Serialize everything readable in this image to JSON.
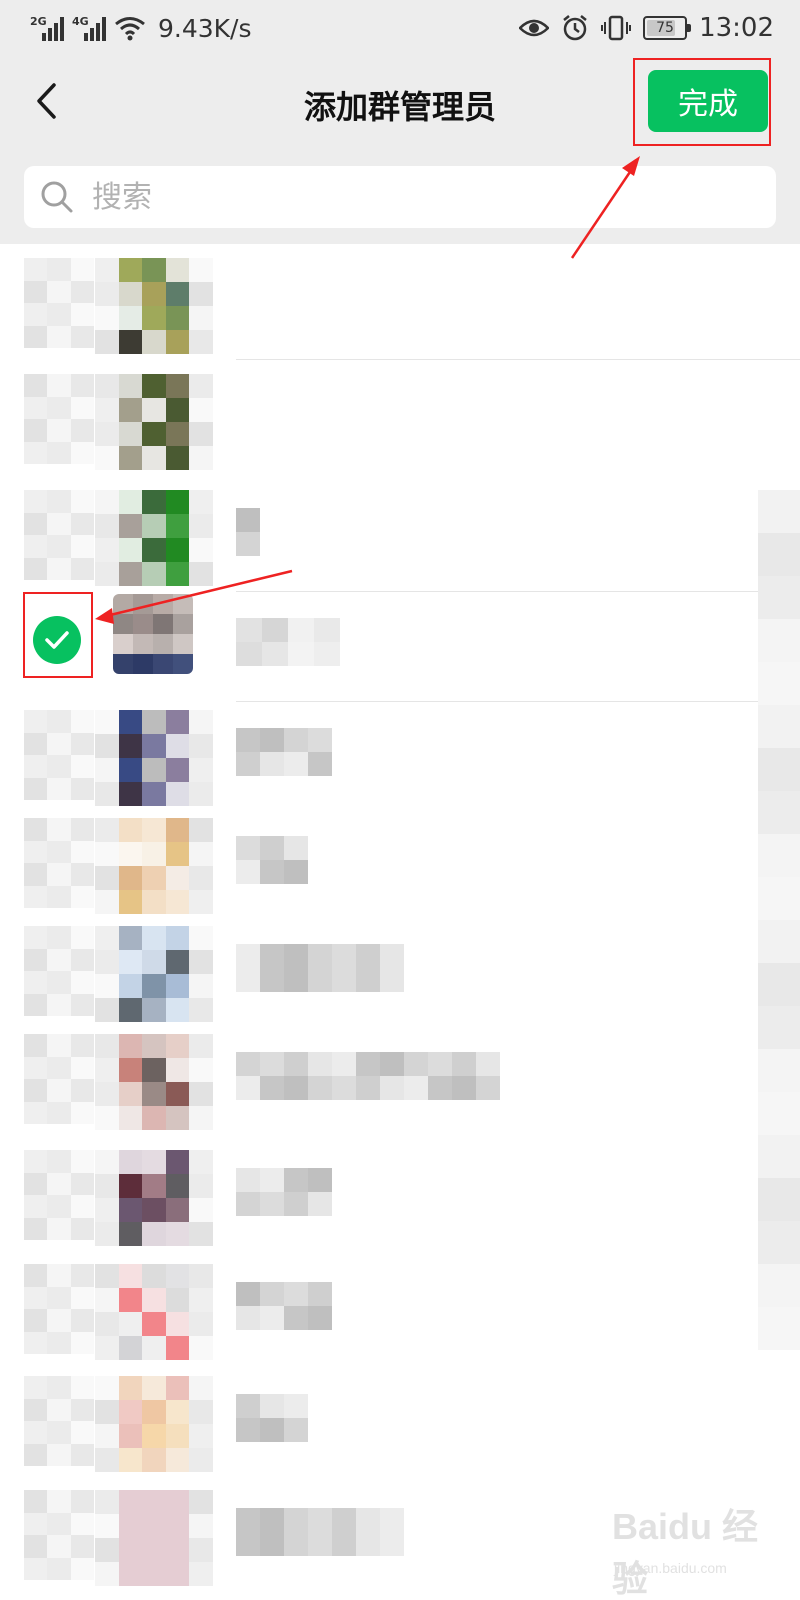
{
  "status_bar": {
    "signal1_gen": "2G",
    "signal2_gen": "4G",
    "net_speed": "9.43K/s",
    "battery_level": "75",
    "time": "13:02",
    "icons": [
      "eye-icon",
      "alarm-icon",
      "vibrate-icon",
      "battery-icon"
    ]
  },
  "header": {
    "title": "添加群管理员",
    "done_label": "完成",
    "back_icon": "chevron-left-icon"
  },
  "search": {
    "placeholder": "搜索"
  },
  "contacts": {
    "selected_index": 3,
    "count": 12
  },
  "watermark": {
    "word": "Baidu 经验",
    "sub": "jingyan.baidu.com"
  },
  "colors": {
    "accent": "#07c160",
    "header_bg": "#ededed",
    "annotation": "#ee2222"
  }
}
